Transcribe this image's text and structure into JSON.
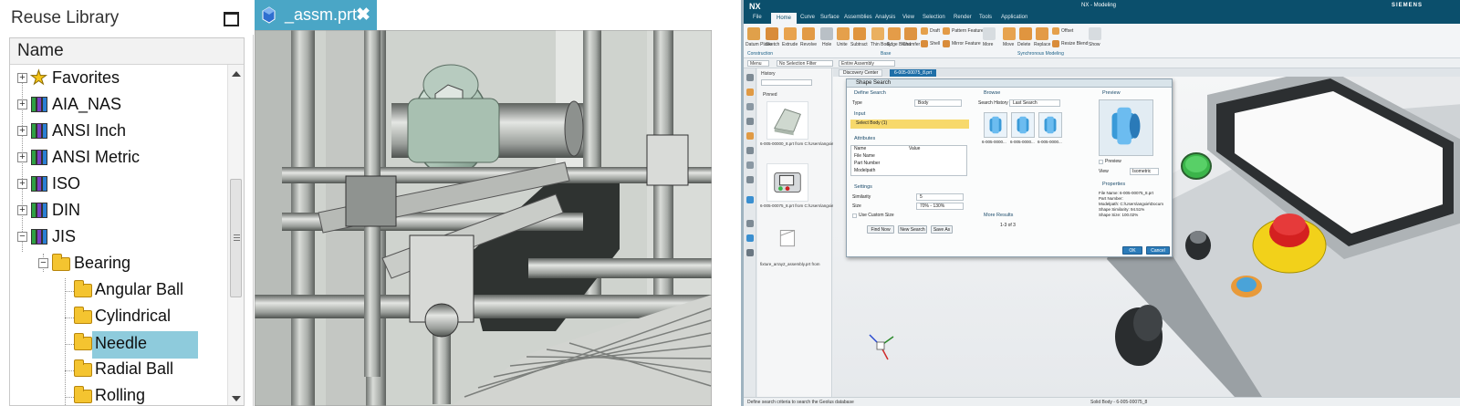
{
  "library": {
    "title": "Reuse Library",
    "column_header": "Name",
    "items": [
      {
        "label": "Favorites",
        "icon": "star-icon",
        "expander": "+"
      },
      {
        "label": "AIA_NAS",
        "icon": "library-books-icon",
        "expander": "+"
      },
      {
        "label": "ANSI Inch",
        "icon": "library-books-icon",
        "expander": "+"
      },
      {
        "label": "ANSI Metric",
        "icon": "library-books-icon",
        "expander": "+"
      },
      {
        "label": "ISO",
        "icon": "library-books-icon",
        "expander": "+"
      },
      {
        "label": "DIN",
        "icon": "library-books-icon",
        "expander": "+"
      },
      {
        "label": "JIS",
        "icon": "library-books-icon",
        "expander": "−"
      },
      {
        "label": "Bearing",
        "icon": "folder-icon",
        "expander": "−"
      },
      {
        "label": "Angular Ball",
        "icon": "folder-icon"
      },
      {
        "label": "Cylindrical",
        "icon": "folder-icon"
      },
      {
        "label": "Needle",
        "icon": "folder-icon",
        "selected": true
      },
      {
        "label": "Radial Ball",
        "icon": "folder-icon"
      },
      {
        "label": "Rolling",
        "icon": "folder-icon"
      }
    ]
  },
  "viewport": {
    "tab_label": "_assm.prt",
    "tab_close": "✖"
  },
  "nx": {
    "logo": "NX",
    "app_title": "NX - Modeling",
    "brand": "SIEMENS",
    "menu": [
      "File",
      "Home",
      "Curve",
      "Surface",
      "Assemblies",
      "Analysis",
      "View",
      "Selection",
      "Render",
      "Tools",
      "Application"
    ],
    "menu_active": "Home",
    "ribbon_tools": [
      "Datum Plane",
      "Sketch",
      "Extrude",
      "Revolve",
      "Hole",
      "Unite",
      "Subtract",
      "Thin Body",
      "Edge Blend",
      "Chamfer",
      "Draft",
      "Shell",
      "Pattern Feature",
      "Mirror Feature",
      "More",
      "Move",
      "Delete",
      "Replace",
      "Offset",
      "Resize Blend",
      "Show"
    ],
    "ribbon_groups": [
      "Construction",
      "Base",
      "Synchronous Modeling"
    ],
    "selection_bar": {
      "menu": "Menu",
      "filter": "No Selection Filter",
      "scope": "Entire Assembly"
    },
    "history": {
      "title": "History",
      "pinned": "Pinned",
      "entries": [
        "6-005-00000_8.prt from C:\\Users\\angxie\\Documen...",
        "6-005-00075_8.prt from C:\\Users\\angxie\\Documen...",
        "fixture_array2_assembly.prt from"
      ]
    },
    "doc_tabs": [
      "Discovery Center",
      "6-005-00075_8.prt"
    ],
    "status_left": "Define search criteria to search the Geolus database",
    "status_mid": "Solid Body - 6-005-00075_8",
    "dialog": {
      "title": "Shape Search",
      "define_search": "Define Search",
      "type_label": "Type",
      "type_value": "Body",
      "input": "Input",
      "select_body": "Select Body (1)",
      "attributes": "Attributes",
      "attr_cols": [
        "Name",
        "Value"
      ],
      "attr_rows": [
        "File Name",
        "Part Number",
        "Modelpath"
      ],
      "settings": "Settings",
      "similarity_label": "Similarity",
      "similarity_value": "5",
      "size_label": "Size",
      "size_value": "70% - 130%",
      "use_custom_size": "Use Custom Size",
      "buttons": [
        "Find Now",
        "New Search",
        "Save As"
      ],
      "browse": "Browse",
      "search_history_label": "Search History",
      "search_history_value": "Last Search",
      "results": [
        "6-005-0000...",
        "6-005-0000...",
        "6-005-0000..."
      ],
      "more_results": "More Results",
      "pager": "1-3 of 3",
      "preview_header": "Preview",
      "preview_check": "Preview",
      "view_label": "View",
      "view_value": "Isometric",
      "properties": "Properties",
      "prop_lines": [
        "File Name: 6-005-00075_8.prt",
        "Part Number:",
        "Modelpath: C:\\Users\\angxie\\Docum",
        "Shape Similarity: 94.51%",
        "Shape Size: 100.02%"
      ],
      "ok": "OK",
      "cancel": "Cancel"
    }
  },
  "colors": {
    "tab_blue": "#4aa6c6",
    "selection": "#8ecbdc",
    "nx_titlebar": "#0b4f6c"
  }
}
